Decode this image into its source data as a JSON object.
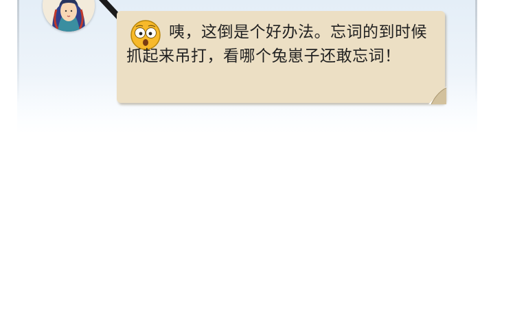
{
  "dialog": {
    "speech_text": "咦，这倒是个好办法。忘词的到时候抓起来吊打，看哪个兔崽子还敢忘词！"
  },
  "icons": {
    "avatar": "character-portrait",
    "pen": "pen-icon",
    "emoji": "surprised-face-icon"
  },
  "colors": {
    "panel_background": "#e4eef7",
    "bubble_fill": "#ecdfc4",
    "text": "#222222",
    "emoji_fill": "#f7b92b"
  }
}
